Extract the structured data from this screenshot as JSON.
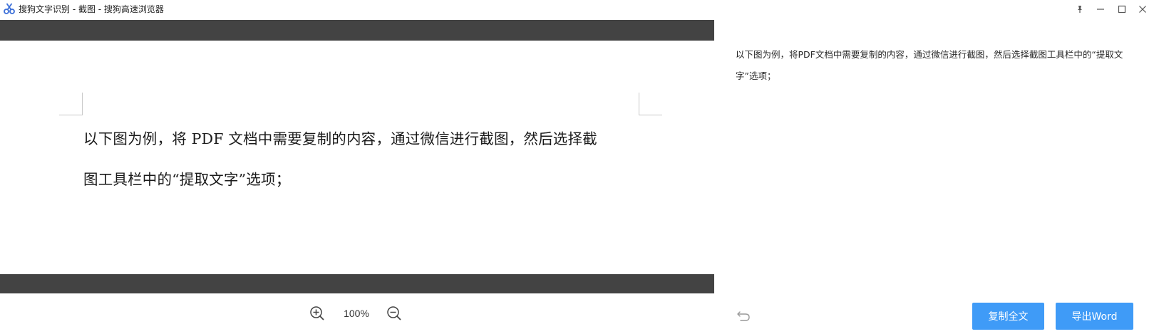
{
  "window": {
    "title": "搜狗文字识别 - 截图 - 搜狗高速浏览器",
    "app_icon": "scissors-icon",
    "controls": [
      "pin-icon",
      "minimize-icon",
      "maximize-icon",
      "close-icon"
    ]
  },
  "preview": {
    "lines": [
      "以下图为例，将 PDF 文档中需要复制的内容，通过微信进行截图，然后选择截",
      "图工具栏中的“提取文字”选项；"
    ],
    "zoom_level": "100%",
    "zoom_in_icon": "zoom-in-icon",
    "zoom_out_icon": "zoom-out-icon",
    "band_color": "#434343"
  },
  "result": {
    "text": "以下图为例，将PDF文档中需要复制的内容，通过微信进行截图，然后选择截图工具栏中的“提取文字”选项；",
    "undo_icon": "undo-icon",
    "copy_all_label": "复制全文",
    "export_word_label": "导出Word",
    "button_color": "#3f9bf7"
  }
}
